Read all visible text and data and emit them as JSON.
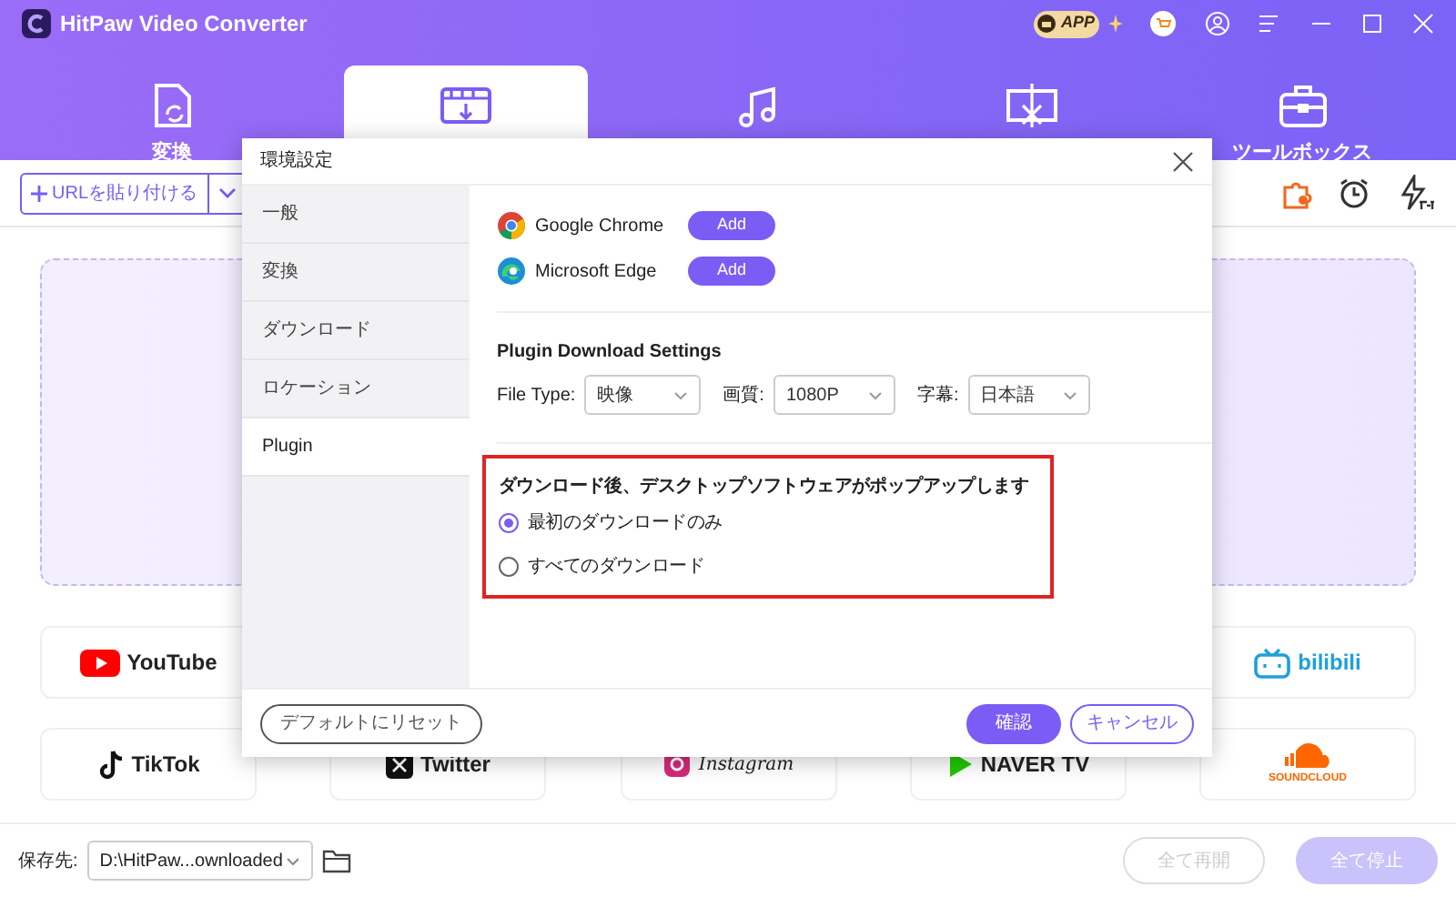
{
  "window": {
    "title": "HitPaw Video Converter",
    "app_badge": "APP"
  },
  "tabs": [
    {
      "kind": "convert",
      "label": "変換",
      "selected": false
    },
    {
      "kind": "download",
      "selected": true
    },
    {
      "kind": "music",
      "selected": false
    },
    {
      "kind": "edit",
      "selected": false
    },
    {
      "kind": "toolbox",
      "label": "ツールボックス",
      "selected": false
    }
  ],
  "toolbar": {
    "paste_button": "URLを貼り付ける"
  },
  "platforms": [
    {
      "kind": "youtube",
      "label": "YouTube"
    },
    {
      "kind": "bilibili",
      "label": "bilibili"
    },
    {
      "kind": "tiktok",
      "label": "TikTok"
    },
    {
      "kind": "twitter",
      "label": "Twitter"
    },
    {
      "kind": "instagram",
      "label": "Instagram"
    },
    {
      "kind": "naver",
      "label": "NAVER TV"
    },
    {
      "kind": "soundcloud",
      "label": "SOUNDCLOUD"
    }
  ],
  "bottom_bar": {
    "save_label": "保存先:",
    "save_path": "D:\\HitPaw...ownloaded",
    "buttons": [
      {
        "label": "全て再開",
        "kind": "outline",
        "disabled": true
      },
      {
        "label": "全て停止",
        "kind": "fill",
        "disabled": true
      }
    ]
  },
  "dialog": {
    "title": "環境設定",
    "sidebar": [
      {
        "label": "一般",
        "selected": false
      },
      {
        "label": "変換",
        "selected": false
      },
      {
        "label": "ダウンロード",
        "selected": false
      },
      {
        "label": "ロケーション",
        "selected": false
      },
      {
        "label": "Plugin",
        "selected": true
      }
    ],
    "browsers": [
      {
        "kind": "chrome",
        "name": "Google Chrome",
        "button": "Add"
      },
      {
        "kind": "edge",
        "name": "Microsoft Edge",
        "button": "Add"
      }
    ],
    "section_title": "Plugin Download Settings",
    "selects": [
      {
        "label": "File Type:",
        "value": "映像"
      },
      {
        "label": "画質:",
        "value": "1080P"
      },
      {
        "label": "字幕:",
        "value": "日本語"
      }
    ],
    "popup_group": {
      "title": "ダウンロード後、デスクトップソフトウェアがポップアップします",
      "highlighted": true,
      "options": [
        {
          "label": "最初のダウンロードのみ",
          "selected": true
        },
        {
          "label": "すべてのダウンロード",
          "selected": false
        }
      ]
    },
    "reset_button": "デフォルトにリセット",
    "confirm_button": "確認",
    "cancel_button": "キャンセル"
  }
}
